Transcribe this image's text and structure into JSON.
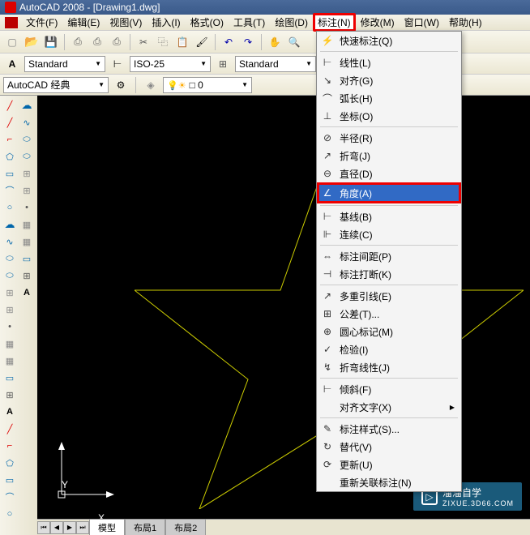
{
  "titlebar": {
    "text": "AutoCAD 2008 - [Drawing1.dwg]"
  },
  "menubar": {
    "items": [
      {
        "label": "文件(F)",
        "key": "F"
      },
      {
        "label": "编辑(E)",
        "key": "E"
      },
      {
        "label": "视图(V)",
        "key": "V"
      },
      {
        "label": "插入(I)",
        "key": "I"
      },
      {
        "label": "格式(O)",
        "key": "O"
      },
      {
        "label": "工具(T)",
        "key": "T"
      },
      {
        "label": "绘图(D)",
        "key": "D"
      },
      {
        "label": "标注(N)",
        "key": "N",
        "highlighted": true
      },
      {
        "label": "修改(M)",
        "key": "M"
      },
      {
        "label": "窗口(W)",
        "key": "W"
      },
      {
        "label": "帮助(H)",
        "key": "H"
      }
    ]
  },
  "toolbar2": {
    "text_style": "Standard",
    "dim_style": "ISO-25",
    "table_style": "Standard"
  },
  "toolbar3": {
    "workspace": "AutoCAD 经典",
    "layer": "0",
    "layer_byblock": "□ 0"
  },
  "tabs": {
    "items": [
      "模型",
      "布局1",
      "布局2"
    ],
    "active": 0
  },
  "ucs": {
    "x_label": "X",
    "y_label": "Y"
  },
  "dropdown": {
    "items": [
      {
        "icon": "⚡",
        "label": "快速标注(Q)"
      },
      {
        "sep": true
      },
      {
        "icon": "⊢",
        "label": "线性(L)"
      },
      {
        "icon": "↘",
        "label": "对齐(G)"
      },
      {
        "icon": "⌒",
        "label": "弧长(H)"
      },
      {
        "icon": "⊥",
        "label": "坐标(O)"
      },
      {
        "sep": true
      },
      {
        "icon": "⊘",
        "label": "半径(R)"
      },
      {
        "icon": "↗",
        "label": "折弯(J)"
      },
      {
        "icon": "⊖",
        "label": "直径(D)"
      },
      {
        "icon": "∠",
        "label": "角度(A)",
        "highlighted": true
      },
      {
        "sep": true
      },
      {
        "icon": "⊢",
        "label": "基线(B)"
      },
      {
        "icon": "⊩",
        "label": "连续(C)"
      },
      {
        "sep": true
      },
      {
        "icon": "⇔",
        "label": "标注间距(P)"
      },
      {
        "icon": "⊣",
        "label": "标注打断(K)"
      },
      {
        "sep": true
      },
      {
        "icon": "↗",
        "label": "多重引线(E)"
      },
      {
        "icon": "⊞",
        "label": "公差(T)..."
      },
      {
        "icon": "⊕",
        "label": "圆心标记(M)"
      },
      {
        "icon": "✓",
        "label": "检验(I)"
      },
      {
        "icon": "↯",
        "label": "折弯线性(J)"
      },
      {
        "sep": true
      },
      {
        "icon": "⊢",
        "label": "倾斜(F)"
      },
      {
        "icon": "",
        "label": "对齐文字(X)",
        "arrow": true
      },
      {
        "sep": true
      },
      {
        "icon": "✎",
        "label": "标注样式(S)..."
      },
      {
        "icon": "↻",
        "label": "替代(V)"
      },
      {
        "icon": "⟳",
        "label": "更新(U)"
      },
      {
        "icon": "",
        "label": "重新关联标注(N)"
      }
    ]
  },
  "watermark": {
    "main": "溜溜自学",
    "sub": "ZIXUE.3D66.COM",
    "play": "▷"
  }
}
